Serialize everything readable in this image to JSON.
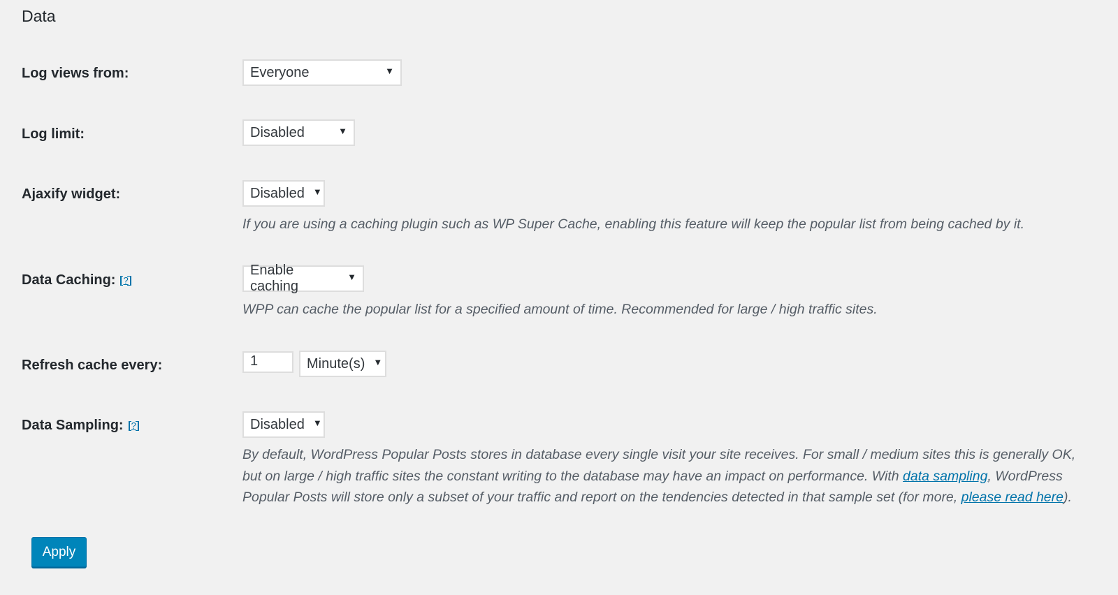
{
  "section": {
    "title": "Data"
  },
  "fields": {
    "log_views_from": {
      "label": "Log views from:",
      "value": "Everyone"
    },
    "log_limit": {
      "label": "Log limit:",
      "value": "Disabled"
    },
    "ajaxify_widget": {
      "label": "Ajaxify widget:",
      "value": "Disabled",
      "description": "If you are using a caching plugin such as WP Super Cache, enabling this feature will keep the popular list from being cached by it."
    },
    "data_caching": {
      "label": "Data Caching:",
      "help": "?",
      "value": "Enable caching",
      "description": "WPP can cache the popular list for a specified amount of time. Recommended for large / high traffic sites."
    },
    "refresh_cache": {
      "label": "Refresh cache every:",
      "interval_value": "1",
      "unit_value": "Minute(s)"
    },
    "data_sampling": {
      "label": "Data Sampling:",
      "help": "?",
      "value": "Disabled",
      "description_part1": "By default, WordPress Popular Posts stores in database every single visit your site receives. For small / medium sites this is generally OK, but on large / high traffic sites the constant writing to the database may have an impact on performance. With ",
      "link1": "data sampling",
      "description_part2": ", WordPress Popular Posts will store only a subset of your traffic and report on the tendencies detected in that sample set (for more, ",
      "link2": "please read here",
      "description_part3": ")."
    }
  },
  "actions": {
    "apply_label": "Apply"
  },
  "icons": {
    "dropdown": "triangle-down-icon",
    "help": "help-bracket-icon"
  },
  "colors": {
    "accent": "#0085ba",
    "link": "#0073aa",
    "background": "#f1f1f1"
  }
}
